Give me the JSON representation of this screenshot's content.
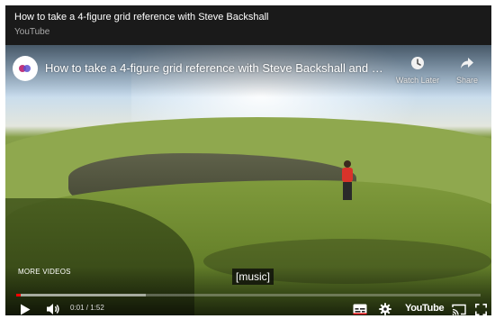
{
  "embed": {
    "title": "How to take a 4-figure grid reference with Steve Backshall",
    "source": "YouTube"
  },
  "player": {
    "video_title": "How to take a 4-figure grid reference with Steve Backshall and Ord...",
    "channel_avatar_icon": "channel-logo-icon",
    "watch_later_label": "Watch Later",
    "share_label": "Share",
    "more_videos_label": "MORE VIDEOS",
    "caption_text": "[music]",
    "current_time": "0:01",
    "duration": "1:52",
    "time_display": "0:01 / 1:52",
    "progress_fraction": 0.009,
    "buffered_fraction": 0.28,
    "logo_text": "YouTube",
    "accent_color": "#ff0000",
    "controls": {
      "play_icon": "play-icon",
      "volume_icon": "volume-icon",
      "subtitles_icon": "subtitles-icon",
      "settings_icon": "gear-icon",
      "cast_icon": "cast-icon",
      "fullscreen_icon": "fullscreen-icon"
    }
  }
}
